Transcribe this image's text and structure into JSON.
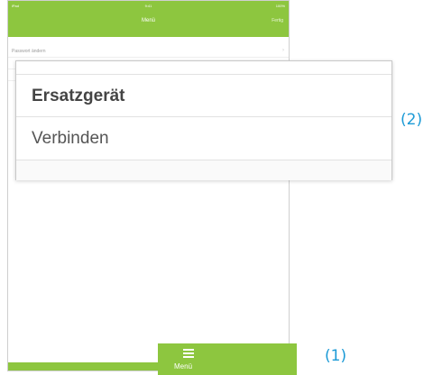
{
  "app": {
    "status_bar": {
      "left": "iPad",
      "time": "9:41",
      "right": "100%"
    },
    "nav_bar": {
      "title": "Menü",
      "done_label": "Fertig"
    },
    "list_items": [
      {
        "label": "Passwort ändern"
      },
      {
        "label": ""
      },
      {
        "label": ""
      }
    ]
  },
  "popup": {
    "items": [
      {
        "label": "Ersatzgerät"
      },
      {
        "label": "Verbinden"
      }
    ]
  },
  "menu_tab": {
    "label": "Menü"
  },
  "callouts": {
    "one": "(1)",
    "two": "(2)"
  },
  "colors": {
    "accent_green": "#8dc63f",
    "callout_blue": "#1b9ad6"
  }
}
